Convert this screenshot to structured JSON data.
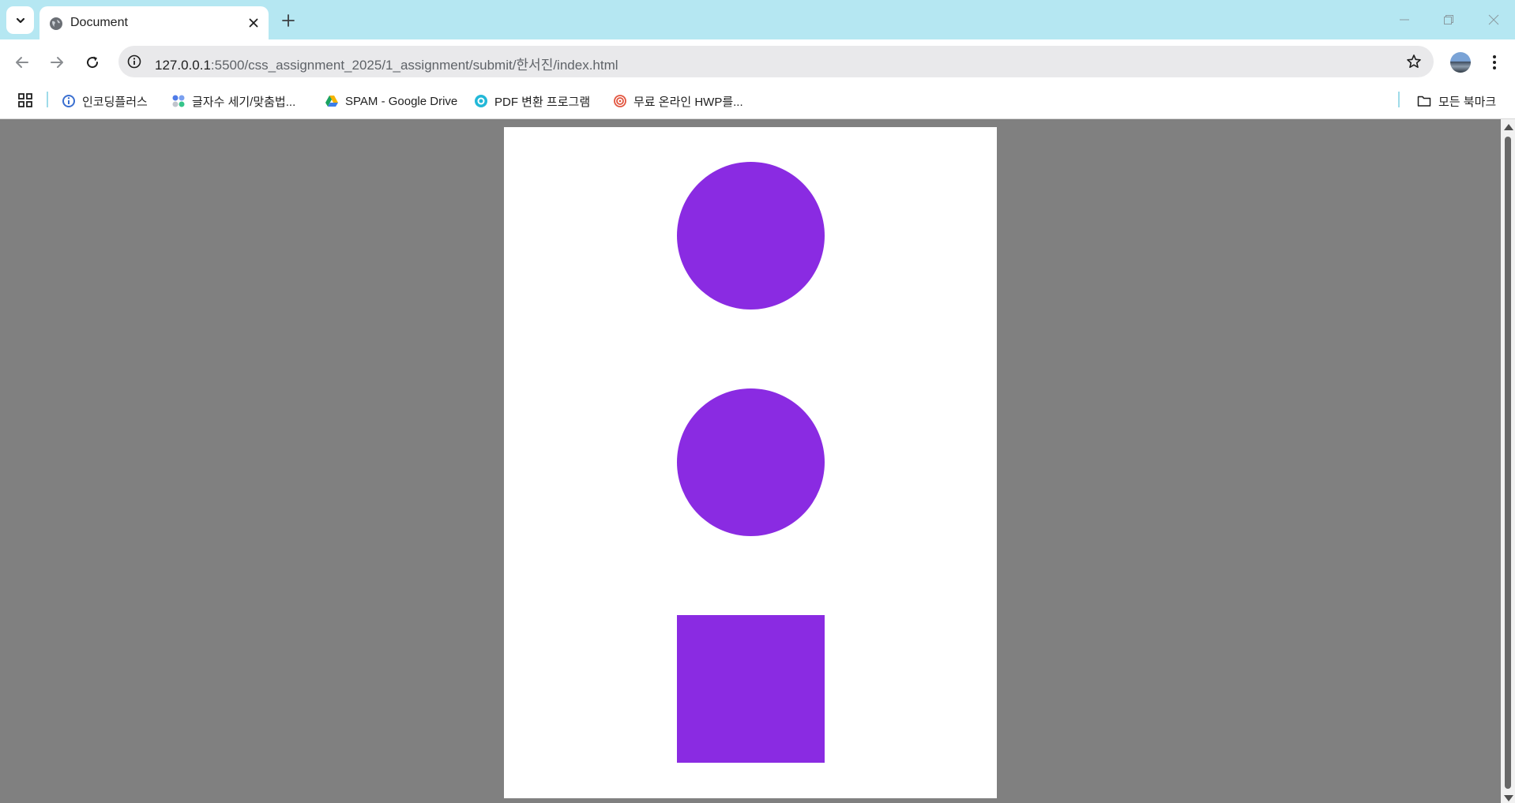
{
  "tab": {
    "title": "Document"
  },
  "address_bar": {
    "host": "127.0.0.1",
    "path": ":5500/css_assignment_2025/1_assignment/submit/한서진/index.html"
  },
  "bookmarks": {
    "items": [
      {
        "label": "인코딩플러스",
        "icon": "info-circle-icon"
      },
      {
        "label": "글자수 세기/맞춤법...",
        "icon": "dots-grid-icon"
      },
      {
        "label": "SPAM - Google Drive",
        "icon": "google-drive-icon"
      },
      {
        "label": "PDF 변환 프로그램",
        "icon": "pdf-converter-icon"
      },
      {
        "label": "무료 온라인 HWP를...",
        "icon": "spiral-icon"
      }
    ],
    "all_bookmarks_label": "모든 북마크"
  },
  "page": {
    "background": "#808080",
    "document_background": "#ffffff",
    "shapes": [
      {
        "type": "circle",
        "color": "#8a2be2"
      },
      {
        "type": "circle",
        "color": "#8a2be2"
      },
      {
        "type": "square",
        "color": "#8a2be2"
      }
    ]
  },
  "colors": {
    "titlebar": "#b5e7f2",
    "accent_separator": "#9fdbe9"
  }
}
